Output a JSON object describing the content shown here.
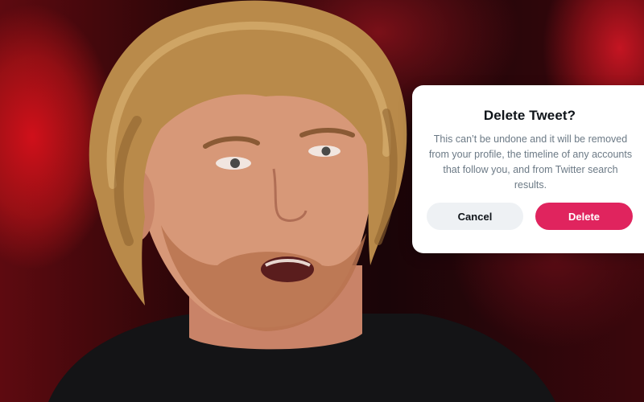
{
  "dialog": {
    "title": "Delete Tweet?",
    "message": "This can’t be undone and it will be removed from your profile, the timeline of any accounts that follow you, and from Twitter search results.",
    "cancel_label": "Cancel",
    "delete_label": "Delete"
  },
  "colors": {
    "delete_button": "#e0245e",
    "cancel_button": "#eef1f4",
    "background_red": "#c41522"
  }
}
